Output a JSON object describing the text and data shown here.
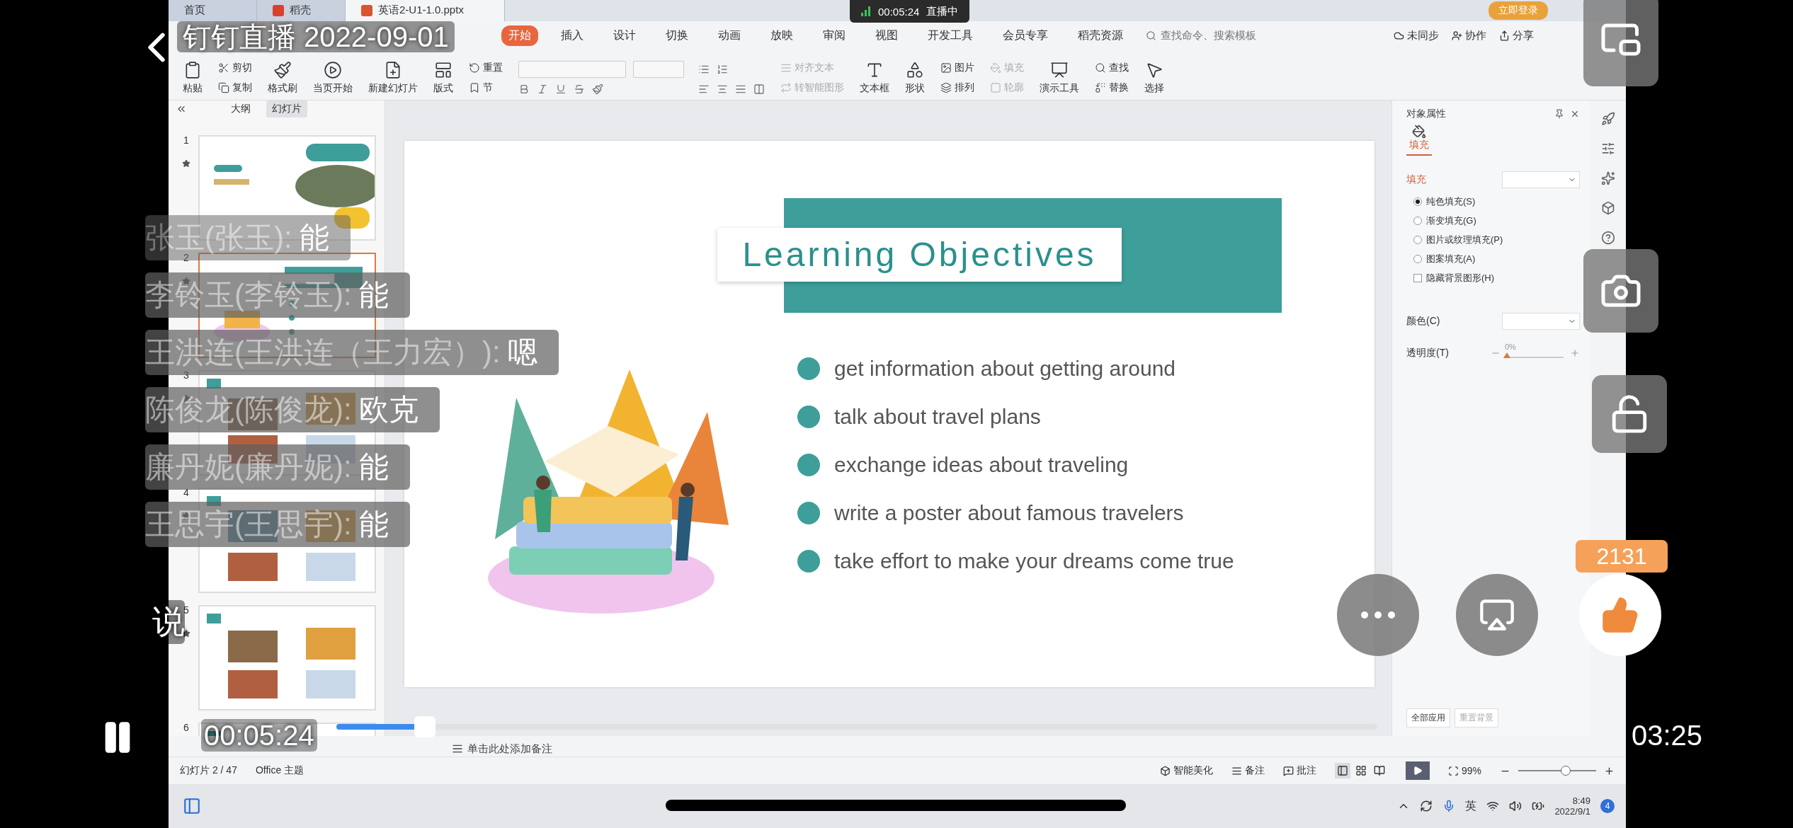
{
  "player": {
    "title": "钉钉直播 2022-09-01",
    "live_badge": {
      "time": "00:05:24",
      "status": "直播中"
    },
    "current_time": "00:05:24",
    "total_time": "03:25",
    "progress": {
      "level": 0.085
    },
    "like_count": "2131",
    "comment_prompt": "说"
  },
  "comments": [
    {
      "author": "张玉(张玉):",
      "message": "能",
      "faded": true
    },
    {
      "author": "李铃玉(李铃玉):",
      "message": "能",
      "faded": false
    },
    {
      "author": "王洪连(王洪连（王力宏）):",
      "message": "嗯",
      "faded": false
    },
    {
      "author": "陈俊龙(陈俊龙):",
      "message": "欧克",
      "faded": false
    },
    {
      "author": "廉丹妮(廉丹妮):",
      "message": "能",
      "faded": false
    },
    {
      "author": "王思宇(王思宇):",
      "message": "能",
      "faded": false
    }
  ],
  "window": {
    "tabs": [
      {
        "label": "首页",
        "selected": false
      },
      {
        "label": "稻壳",
        "selected": false
      },
      {
        "label": "英语2-U1-1.0.pptx",
        "selected": true
      }
    ],
    "login": "立即登录"
  },
  "ribbon": {
    "menu": [
      {
        "label": "开始",
        "selected": true
      },
      {
        "label": "插入",
        "selected": false
      },
      {
        "label": "设计",
        "selected": false
      },
      {
        "label": "切换",
        "selected": false
      },
      {
        "label": "动画",
        "selected": false
      },
      {
        "label": "放映",
        "selected": false
      },
      {
        "label": "审阅",
        "selected": false
      },
      {
        "label": "视图",
        "selected": false
      },
      {
        "label": "开发工具",
        "selected": false
      },
      {
        "label": "会员专享",
        "selected": false
      },
      {
        "label": "稻壳资源",
        "selected": false
      }
    ],
    "search": {
      "placeholder": "查找命令、搜索模板"
    },
    "actions": [
      "未同步",
      "协作",
      "分享"
    ],
    "tools": [
      {
        "kind": "big",
        "disabled": false,
        "label": "粘贴"
      },
      {
        "kind": "pair",
        "disabled": false,
        "items": [
          "剪切",
          "复制"
        ]
      },
      {
        "kind": "big",
        "disabled": false,
        "label": "格式刷"
      },
      {
        "kind": "big",
        "disabled": false,
        "label": "当页开始"
      },
      {
        "kind": "big",
        "disabled": false,
        "label": "新建幻灯片"
      },
      {
        "kind": "big",
        "disabled": false,
        "label": "版式"
      },
      {
        "kind": "pair",
        "disabled": false,
        "items": [
          "重置",
          "节"
        ]
      },
      {
        "kind": "font",
        "disabled": false
      },
      {
        "kind": "pair",
        "disabled": true,
        "items": [
          "对齐文本",
          "转智能图形"
        ]
      },
      {
        "kind": "big",
        "disabled": false,
        "label": "文本框"
      },
      {
        "kind": "big",
        "disabled": false,
        "label": "形状"
      },
      {
        "kind": "pair",
        "disabled": false,
        "items": [
          "图片",
          "排列"
        ]
      },
      {
        "kind": "pair",
        "disabled": true,
        "items": [
          "填充",
          "轮廓"
        ]
      },
      {
        "kind": "big",
        "disabled": false,
        "label": "演示工具"
      },
      {
        "kind": "pair",
        "disabled": false,
        "items": [
          "查找",
          "替换"
        ]
      },
      {
        "kind": "big",
        "disabled": false,
        "label": "选择"
      }
    ]
  },
  "slides_panel": {
    "tabs": [
      {
        "label": "大纲",
        "selected": false
      },
      {
        "label": "幻灯片",
        "selected": true
      }
    ],
    "thumbnails": [
      {
        "number": "1",
        "selected": false
      },
      {
        "number": "2",
        "selected": true
      },
      {
        "number": "3",
        "selected": false
      },
      {
        "number": "4",
        "selected": false
      },
      {
        "number": "5",
        "selected": false
      },
      {
        "number": "6",
        "selected": false
      }
    ]
  },
  "slide": {
    "title": "Learning Objectives",
    "bullets": [
      "get information about getting around",
      "talk about travel plans",
      "exchange ideas about traveling",
      "write a poster about famous travelers",
      "take effort to make your dreams come true"
    ]
  },
  "notes": {
    "placeholder": "单击此处添加备注"
  },
  "properties": {
    "title": "对象属性",
    "tab": "填充",
    "section": "填充",
    "options": [
      {
        "kind": "radio",
        "label": "纯色填充(S)",
        "selected": true
      },
      {
        "kind": "radio",
        "label": "渐变填充(G)",
        "selected": false
      },
      {
        "kind": "radio",
        "label": "图片或纹理填充(P)",
        "selected": false
      },
      {
        "kind": "radio",
        "label": "图案填充(A)",
        "selected": false
      },
      {
        "kind": "checkbox",
        "label": "隐藏背景图形(H)",
        "checked": false
      }
    ],
    "color_label": "颜色(C)",
    "transparency": {
      "label": "透明度(T)",
      "reading": "0%",
      "level": 0
    },
    "buttons": [
      "全部应用",
      "重置背景"
    ]
  },
  "status_bar": {
    "slide_info": "幻灯片 2 / 47",
    "theme": "Office 主题",
    "beautify": "智能美化",
    "notes": "备注",
    "comments": "批注",
    "views": [
      {
        "selected": true
      },
      {
        "selected": false
      },
      {
        "selected": false
      }
    ],
    "zoom": "99%",
    "zoom_slider": {
      "level": 0.6
    }
  },
  "taskbar": {
    "language": "英",
    "time": "8:49",
    "date": "2022/9/1",
    "notifications": "4"
  }
}
